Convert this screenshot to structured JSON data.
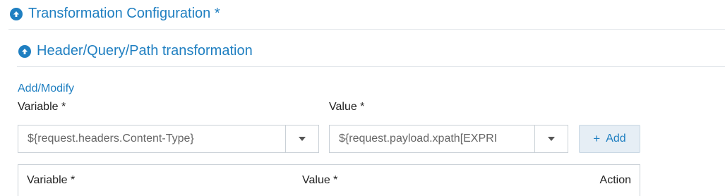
{
  "sections": {
    "main_title": "Transformation Configuration *",
    "sub_title": "Header/Query/Path transformation"
  },
  "add_modify": {
    "title": "Add/Modify",
    "variable_label": "Variable *",
    "value_label": "Value *",
    "variable_value": "${request.headers.Content-Type}",
    "value_value": "${request.payload.xpath[EXPRI",
    "add_button_icon": "+",
    "add_button_label": "Add"
  },
  "table": {
    "columns": [
      "Variable *",
      "Value *",
      "Action"
    ]
  },
  "colors": {
    "accent": "#1f7fc1",
    "border": "#c9d0d6",
    "button_bg": "#e6eef5"
  },
  "icons": {
    "collapse": "arrow-up-circle-icon",
    "dropdown": "caret-down-icon"
  }
}
